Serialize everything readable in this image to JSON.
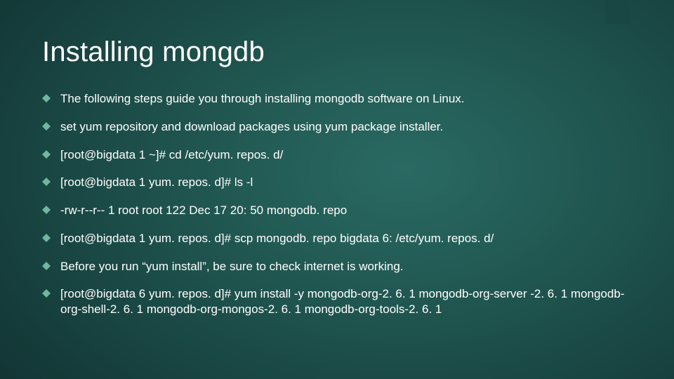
{
  "title": "Installing mongdb",
  "bullets": [
    "The following steps guide you through installing mongodb software on Linux.",
    "set yum repository and download packages using yum package installer.",
    "[root@bigdata 1 ~]# cd /etc/yum. repos. d/",
    "[root@bigdata 1 yum. repos. d]# ls -l",
    "-rw-r--r-- 1 root root  122 Dec 17 20: 50 mongodb. repo",
    "[root@bigdata 1 yum. repos. d]# scp mongodb. repo bigdata 6: /etc/yum. repos. d/",
    "Before you run “yum install”, be sure to check internet is working.",
    "[root@bigdata 6 yum. repos. d]# yum install -y mongodb-org-2. 6. 1 mongodb-org-server -2. 6. 1 mongodb-org-shell-2. 6. 1 mongodb-org-mongos-2. 6. 1 mongodb-org-tools-2. 6. 1"
  ],
  "accent_color": "#6fb79e"
}
